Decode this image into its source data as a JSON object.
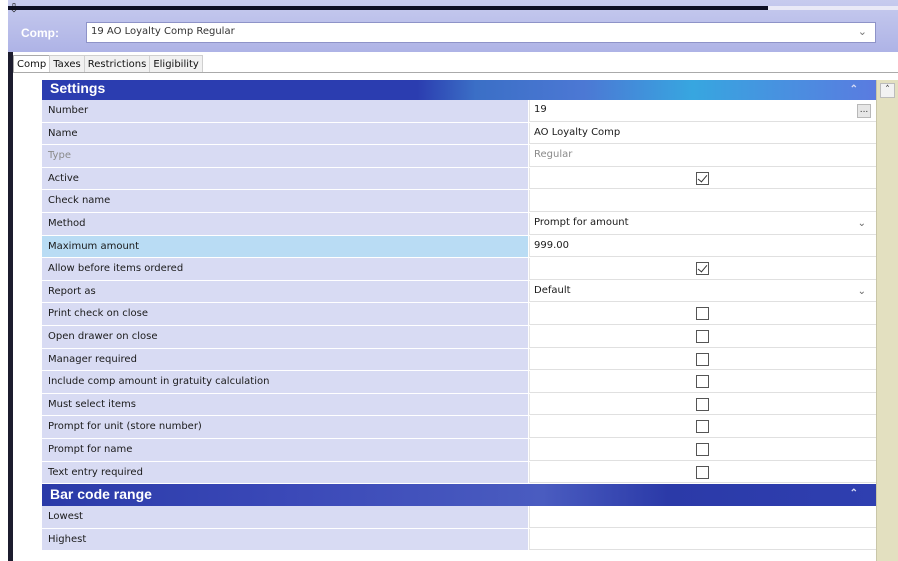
{
  "header": {
    "comp_label": "Comp:",
    "comp_value": "19 AO Loyalty Comp Regular"
  },
  "tabs": [
    {
      "label": "Comp",
      "active": true
    },
    {
      "label": "Taxes",
      "active": false
    },
    {
      "label": "Restrictions",
      "active": false
    },
    {
      "label": "Eligibility",
      "active": false
    }
  ],
  "settings": {
    "title": "Settings",
    "rows": [
      {
        "label": "Number",
        "value": "19"
      },
      {
        "label": "Name",
        "value": "AO Loyalty Comp"
      },
      {
        "label": "Type",
        "value": "Regular"
      },
      {
        "label": "Active",
        "checked": true
      },
      {
        "label": "Check name",
        "value": ""
      },
      {
        "label": "Method",
        "value": "Prompt for amount"
      },
      {
        "label": "Maximum amount",
        "value": "999.00"
      },
      {
        "label": "Allow before items ordered",
        "checked": true
      },
      {
        "label": "Report as",
        "value": "Default"
      },
      {
        "label": "Print check on close",
        "checked": false
      },
      {
        "label": "Open drawer on close",
        "checked": false
      },
      {
        "label": "Manager required",
        "checked": false
      },
      {
        "label": "Include comp amount in gratuity calculation",
        "checked": false
      },
      {
        "label": "Must select items",
        "checked": false
      },
      {
        "label": "Prompt for unit (store number)",
        "checked": false
      },
      {
        "label": "Prompt for name",
        "checked": false
      },
      {
        "label": "Text entry required",
        "checked": false
      }
    ]
  },
  "barcode": {
    "title": "Bar code range",
    "rows": [
      {
        "label": "Lowest",
        "value": ""
      },
      {
        "label": "Highest",
        "value": ""
      }
    ]
  },
  "icons": {
    "ellipsis": "...",
    "collapse": "⌃",
    "dropdown": "⌄",
    "scroll_up": "˄"
  }
}
